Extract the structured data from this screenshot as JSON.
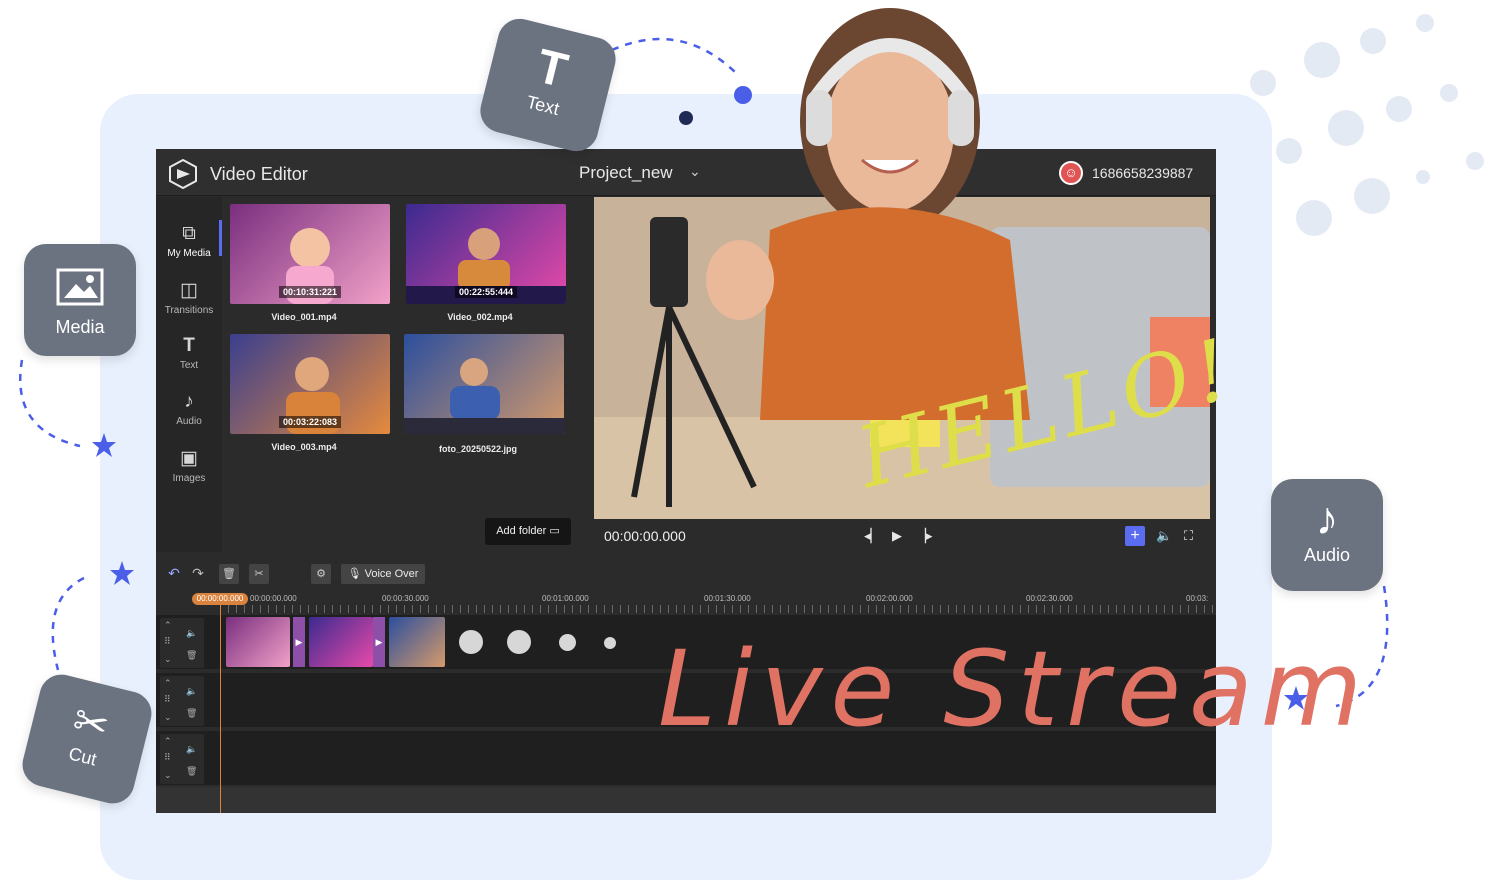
{
  "app": {
    "title": "Video Editor",
    "project_name": "Project_new",
    "user_id": "1686658239887"
  },
  "sidebar": {
    "items": [
      {
        "label": "My Media",
        "icon": "media-library-icon"
      },
      {
        "label": "Transitions",
        "icon": "transitions-icon"
      },
      {
        "label": "Text",
        "icon": "text-icon"
      },
      {
        "label": "Audio",
        "icon": "music-note-icon"
      },
      {
        "label": "Images",
        "icon": "image-icon"
      }
    ]
  },
  "media": {
    "items": [
      {
        "name": "Video_001.mp4",
        "duration": "00:10:31:221",
        "colors": [
          "#7a2f7f",
          "#f2a1c8"
        ]
      },
      {
        "name": "Video_002.mp4",
        "duration": "00:22:55:444",
        "colors": [
          "#3b2a8f",
          "#e74aa9"
        ]
      },
      {
        "name": "Video_003.mp4",
        "duration": "00:03:22:083",
        "colors": [
          "#3a3f8f",
          "#e58a3d"
        ]
      },
      {
        "name": "foto_20250522.jpg",
        "duration": "",
        "colors": [
          "#2c4f9e",
          "#d59a6a"
        ]
      }
    ],
    "add_folder_label": "Add folder"
  },
  "preview": {
    "timecode": "00:00:00.000"
  },
  "timeline": {
    "voice_over_label": "Voice Over",
    "playhead_time": "00:00:00.000",
    "ruler_labels": [
      "00:00:00.000",
      "00:00:30.000",
      "00:01:00.000",
      "00:01:30.000",
      "00:02:00.000",
      "00:02:30.000",
      "00:03:"
    ]
  },
  "float_cards": {
    "text": "Text",
    "media": "Media",
    "audio": "Audio",
    "cut": "Cut"
  },
  "overlay": {
    "hello": "HELLO!",
    "live_stream": "Live Stream"
  },
  "colors": {
    "accent": "#5a6cf0",
    "playhead": "#d9833f",
    "panel_bg": "#e8f0fd",
    "card_bg": "#6b7280",
    "live_stream": "#e07264",
    "hello": "#dede4a"
  }
}
